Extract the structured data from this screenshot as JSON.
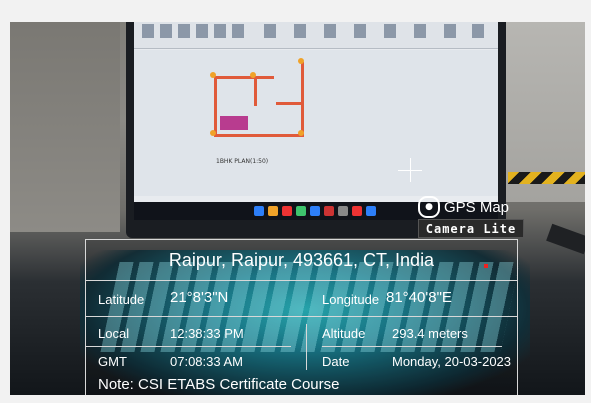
{
  "overlay": {
    "address": "Raipur, Raipur, 493661, CT, India",
    "latitude_label": "Latitude",
    "latitude_value": "21°8'3\"N",
    "longitude_label": "Longitude",
    "longitude_value": "81°40'8\"E",
    "local_label": "Local",
    "local_value": "12:38:33 PM",
    "altitude_label": "Altitude",
    "altitude_value": "293.4 meters",
    "gmt_label": "GMT",
    "gmt_value": "07:08:33 AM",
    "date_label": "Date",
    "date_value": "Monday, 20-03-2023",
    "note_label": "Note:",
    "note_value": "CSI ETABS Certificate Course"
  },
  "branding": {
    "app_name": "GPS Map",
    "app_edition": "Camera Lite"
  },
  "screen": {
    "plan_caption": "1BHK PLAN(1:50)"
  },
  "colors": {
    "wall": "#e05a3a",
    "room": "#b83c8f",
    "hazard_yellow": "#e3b21f",
    "keyboard_glow": "#2ccfd8"
  }
}
